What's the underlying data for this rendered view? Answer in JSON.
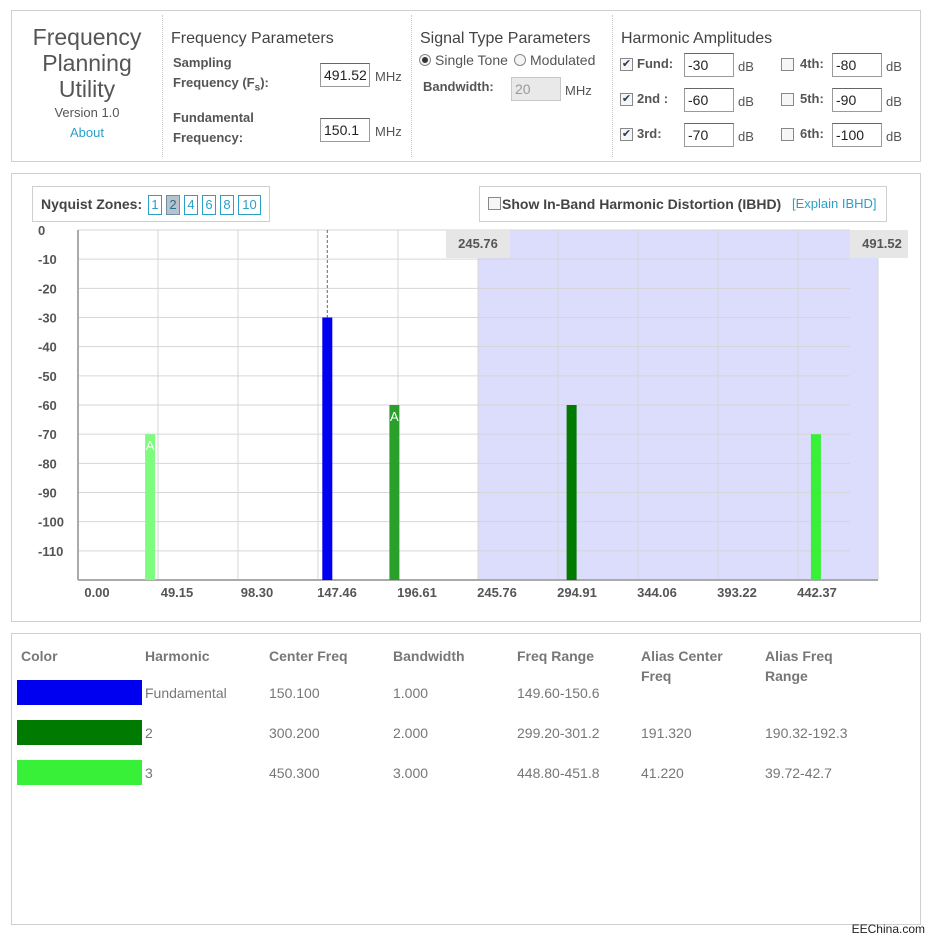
{
  "app": {
    "title_lines": [
      "Frequency",
      "Planning",
      "Utility"
    ],
    "version": "Version 1.0",
    "about": "About"
  },
  "freq_params": {
    "title": "Frequency Parameters",
    "sampling_label_line1": "Sampling",
    "sampling_label_line2": "Frequency (F",
    "sampling_label_sub": "s",
    "sampling_label_end": "):",
    "sampling_value": "491.52",
    "fund_label_line1": "Fundamental",
    "fund_label_line2": "Frequency:",
    "fund_value": "150.1",
    "unit": "MHz"
  },
  "signal_params": {
    "title": "Signal Type Parameters",
    "single_tone": "Single Tone",
    "modulated": "Modulated",
    "bandwidth_label": "Bandwidth:",
    "bandwidth_value": "20",
    "unit": "MHz"
  },
  "harmonics": {
    "title": "Harmonic Amplitudes",
    "unit": "dB",
    "items": [
      {
        "label": "Fund:",
        "value": "-30",
        "checked": true
      },
      {
        "label": "2nd :",
        "value": "-60",
        "checked": true
      },
      {
        "label": "3rd:",
        "value": "-70",
        "checked": true
      },
      {
        "label": "4th:",
        "value": "-80",
        "checked": false
      },
      {
        "label": "5th:",
        "value": "-90",
        "checked": false
      },
      {
        "label": "6th:",
        "value": "-100",
        "checked": false
      }
    ]
  },
  "nyquist": {
    "label": "Nyquist Zones",
    "zones": [
      "1",
      "2",
      "4",
      "6",
      "8",
      "10"
    ],
    "selected": "2"
  },
  "ibhd": {
    "label": "Show In-Band Harmonic Distortion (IBHD)",
    "link": "[Explain IBHD]"
  },
  "chart_data": {
    "type": "bar",
    "x_range": [
      0,
      491.52
    ],
    "y_range": [
      -120,
      0
    ],
    "x_ticks": [
      "0.00",
      "49.15",
      "98.30",
      "147.46",
      "196.61",
      "245.76",
      "294.91",
      "344.06",
      "393.22",
      "442.37"
    ],
    "y_ticks": [
      "0",
      "-10",
      "-20",
      "-30",
      "-40",
      "-50",
      "-60",
      "-70",
      "-80",
      "-90",
      "-100",
      "-110"
    ],
    "shaded_zone": {
      "start": 245.76,
      "end": 491.52,
      "start_label": "245.76",
      "end_label": "491.52",
      "color": "#dcdcfc"
    },
    "marker_freq": 150.1,
    "bars": [
      {
        "freq": 41.22,
        "amplitude": -70,
        "color": "#7dfc7d",
        "label": "A"
      },
      {
        "freq": 150.1,
        "amplitude": -30,
        "color": "#0000f0",
        "label": ""
      },
      {
        "freq": 191.32,
        "amplitude": -60,
        "color": "#2aa02a",
        "label": "A"
      },
      {
        "freq": 300.2,
        "amplitude": -60,
        "color": "#007a00",
        "label": ""
      },
      {
        "freq": 450.3,
        "amplitude": -70,
        "color": "#38f038",
        "label": ""
      }
    ]
  },
  "table": {
    "headers": [
      "Color",
      "Harmonic",
      "Center Freq",
      "Bandwidth",
      "Freq Range",
      "Alias Center Freq",
      "Alias Freq Range"
    ],
    "rows": [
      {
        "color": "#0000f0",
        "harmonic": "Fundamental",
        "center": "150.100",
        "bandwidth": "1.000",
        "range": "149.60-150.6",
        "alias_center": "",
        "alias_range": ""
      },
      {
        "color": "#007a00",
        "harmonic": "2",
        "center": "300.200",
        "bandwidth": "2.000",
        "range": "299.20-301.2",
        "alias_center": "191.320",
        "alias_range": "190.32-192.3"
      },
      {
        "color": "#38f038",
        "harmonic": "3",
        "center": "450.300",
        "bandwidth": "3.000",
        "range": "448.80-451.8",
        "alias_center": "41.220",
        "alias_range": "39.72-42.7"
      }
    ]
  },
  "watermark": "EEChina.com"
}
